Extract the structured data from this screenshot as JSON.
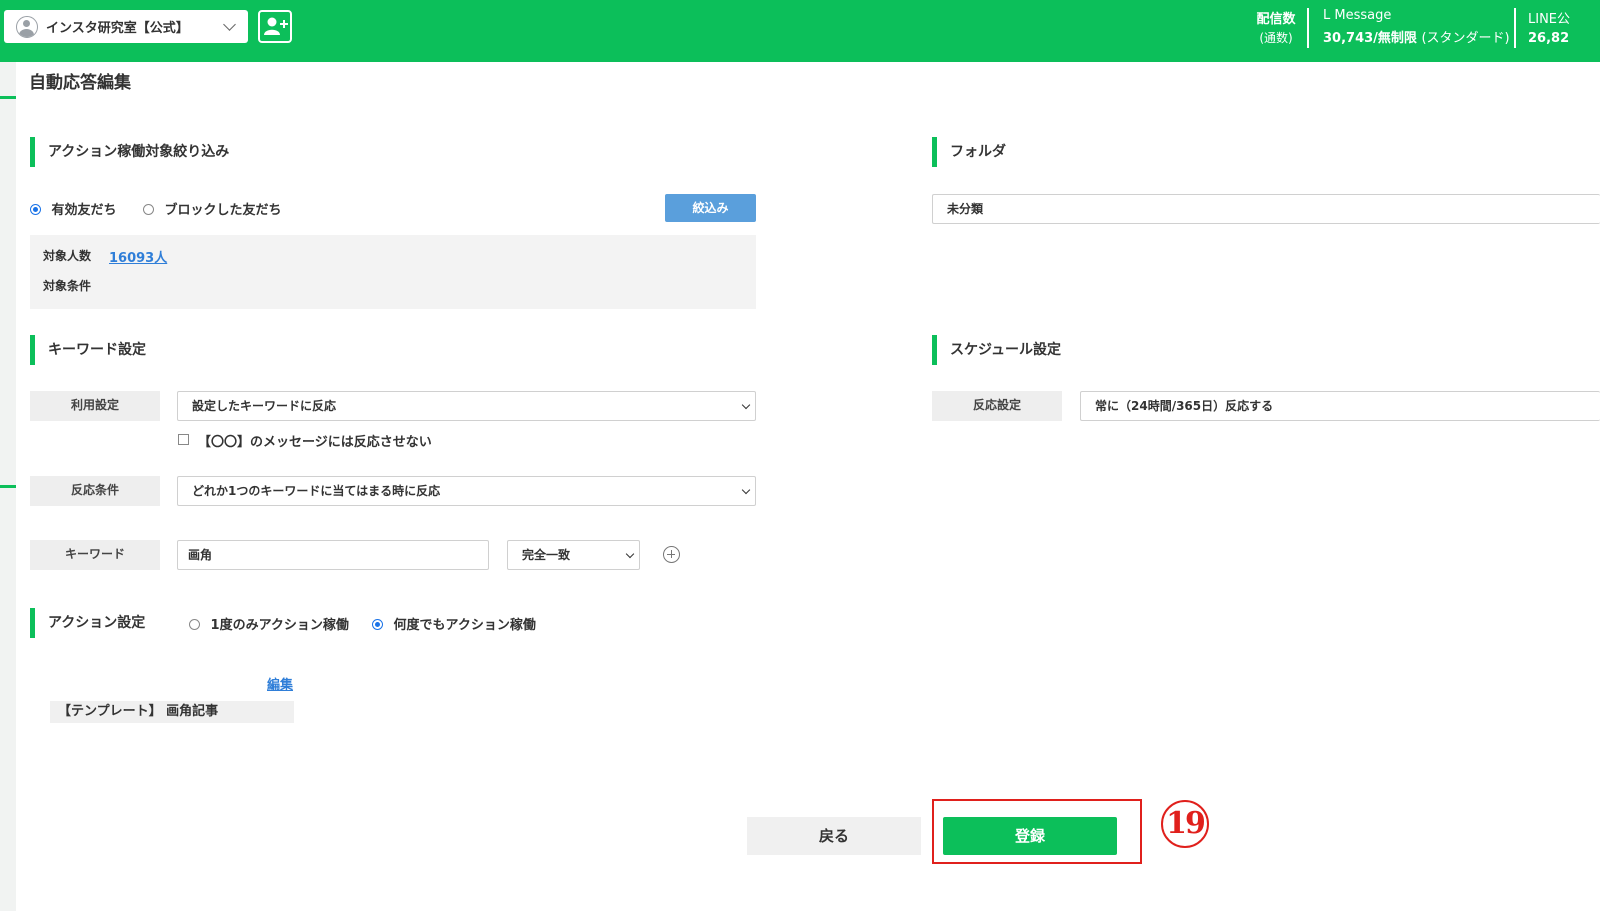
{
  "header": {
    "account_name": "インスタ研究室【公式】",
    "stats": [
      {
        "label": "配信数",
        "sub": "(通数)"
      },
      {
        "label": "L Message",
        "value": "30,743/無制限",
        "plan": "(スタンダード)"
      },
      {
        "label": "LINE公",
        "value": "26,82"
      }
    ]
  },
  "page": {
    "title": "自動応答編集"
  },
  "filter": {
    "section_title": "アクション稼働対象絞り込み",
    "options": [
      "有効友だち",
      "ブロックした友だち"
    ],
    "selected": "有効友だち",
    "filter_button": "絞込み",
    "target_count_label": "対象人数",
    "target_count_value": "16093人",
    "target_condition_label": "対象条件"
  },
  "folder": {
    "section_title": "フォルダ",
    "value": "未分類"
  },
  "keyword": {
    "section_title": "キーワード設定",
    "usage_label": "利用設定",
    "usage_value": "設定したキーワードに反応",
    "ignore_checkbox_label": "【〇〇】のメッセージには反応させない",
    "condition_label": "反応条件",
    "condition_value": "どれか1つのキーワードに当てはまる時に反応",
    "keyword_label": "キーワード",
    "keyword_value": "画角",
    "match_value": "完全一致"
  },
  "schedule": {
    "section_title": "スケジュール設定",
    "reaction_label": "反応設定",
    "reaction_value": "常に（24時間/365日）反応する"
  },
  "action": {
    "section_title": "アクション設定",
    "options": [
      "1度のみアクション稼働",
      "何度でもアクション稼働"
    ],
    "selected": "何度でもアクション稼働",
    "edit_link": "編集",
    "template": "【テンプレート】 画角記事"
  },
  "footer": {
    "back_label": "戻る",
    "register_label": "登録"
  },
  "annotation": {
    "step": "19",
    "color": "#e0201c"
  },
  "colors": {
    "brand_green": "#0cbf5a",
    "filter_blue": "#5a9fdc",
    "link_blue": "#2f7ed8"
  }
}
